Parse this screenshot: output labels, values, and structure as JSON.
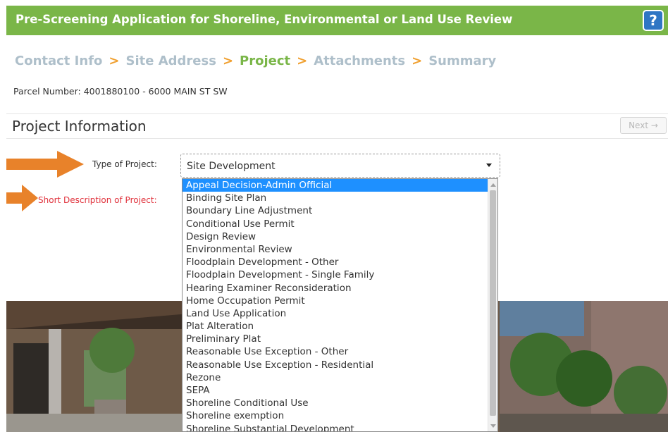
{
  "header": {
    "title": "Pre-Screening Application for Shoreline, Environmental or Land Use Review",
    "help_label": "?",
    "bg_color": "#7ab648"
  },
  "wizard": {
    "steps": [
      "Contact Info",
      "Site Address",
      "Project",
      "Attachments",
      "Summary"
    ],
    "active_step": "Project",
    "separator": ">"
  },
  "parcel": {
    "text": "Parcel Number: 4001880100 - 6000 MAIN ST SW"
  },
  "section": {
    "title": "Project Information",
    "next_label": "Next →"
  },
  "form": {
    "type_label": "Type of Project:",
    "description_label": "Short Description of Project:",
    "selected_value": "Site Development"
  },
  "dropdown": {
    "highlighted": "Appeal Decision-Admin Official",
    "options": [
      "Appeal Decision-Admin Official",
      "Binding Site Plan",
      "Boundary Line Adjustment",
      "Conditional Use Permit",
      "Design Review",
      "Environmental Review",
      "Floodplain Development - Other",
      "Floodplain Development - Single Family",
      "Hearing Examiner Reconsideration",
      "Home Occupation Permit",
      "Land Use Application",
      "Plat Alteration",
      "Preliminary Plat",
      "Reasonable Use Exception - Other",
      "Reasonable Use Exception - Residential",
      "Rezone",
      "SEPA",
      "Shoreline Conditional Use",
      "Shoreline exemption",
      "Shoreline Substantial Development"
    ]
  },
  "colors": {
    "accent_green": "#7ab648",
    "step_inactive": "#aebfca",
    "separator_orange": "#f0a030",
    "arrow_orange": "#e8822a",
    "required_red": "#e0323c",
    "highlight_blue": "#1e90ff",
    "help_blue": "#2f76c4"
  }
}
